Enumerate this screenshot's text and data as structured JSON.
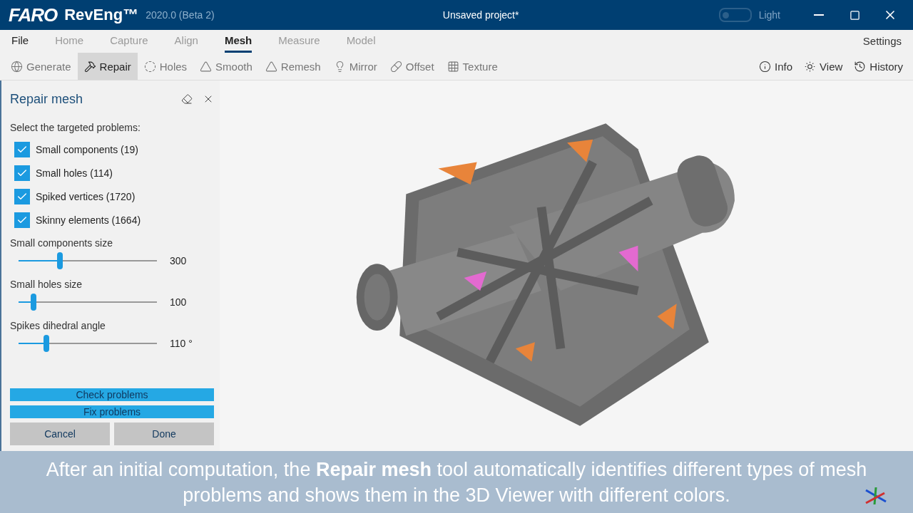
{
  "title_bar": {
    "logo": "FARO",
    "product": "RevEng™",
    "version": "2020.0 (Beta 2)",
    "title": "Unsaved project*",
    "theme_toggle": {
      "label": "Light",
      "on": false
    }
  },
  "menu": [
    {
      "label": "File",
      "disabled": false,
      "selected": false
    },
    {
      "label": "Home",
      "disabled": true,
      "selected": false
    },
    {
      "label": "Capture",
      "disabled": true,
      "selected": false
    },
    {
      "label": "Align",
      "disabled": true,
      "selected": false
    },
    {
      "label": "Mesh",
      "disabled": false,
      "selected": true
    },
    {
      "label": "Measure",
      "disabled": true,
      "selected": false
    },
    {
      "label": "Model",
      "disabled": true,
      "selected": false
    }
  ],
  "menu_right": "Settings",
  "toolbar": [
    {
      "label": "Generate",
      "kind": "generate",
      "selected": false
    },
    {
      "label": "Repair",
      "kind": "repair",
      "selected": true
    },
    {
      "label": "Holes",
      "kind": "holes",
      "selected": false
    },
    {
      "label": "Smooth",
      "kind": "smooth",
      "selected": false
    },
    {
      "label": "Remesh",
      "kind": "remesh",
      "selected": false
    },
    {
      "label": "Mirror",
      "kind": "mirror",
      "selected": false
    },
    {
      "label": "Offset",
      "kind": "offset",
      "selected": false
    },
    {
      "label": "Texture",
      "kind": "texture",
      "selected": false
    }
  ],
  "toolbar_right": [
    {
      "label": "Info",
      "kind": "info"
    },
    {
      "label": "View",
      "kind": "view"
    },
    {
      "label": "History",
      "kind": "history"
    }
  ],
  "panel": {
    "title": "Repair mesh",
    "prompt": "Select the targeted problems:",
    "problems": [
      {
        "label": "Small components (19)",
        "checked": true
      },
      {
        "label": "Small holes (114)",
        "checked": true
      },
      {
        "label": "Spiked vertices (1720)",
        "checked": true
      },
      {
        "label": "Skinny elements (1664)",
        "checked": true
      }
    ],
    "sliders": [
      {
        "label": "Small components size",
        "level": 0.3,
        "reading": "300"
      },
      {
        "label": "Small holes size",
        "level": 0.11,
        "reading": "100"
      },
      {
        "label": "Spikes dihedral angle",
        "level": 0.2,
        "reading": "110 °"
      }
    ],
    "buttons": [
      {
        "label": "Check problems",
        "kind": "primary"
      },
      {
        "label": "Fix problems",
        "kind": "primary"
      },
      {
        "label": "Cancel",
        "kind": "secondary"
      },
      {
        "label": "Done",
        "kind": "secondary"
      }
    ]
  },
  "caption": "After an initial computation, the **Repair mesh** tool automatically identifies different types of mesh problems and shows them in the 3D Viewer with different colors."
}
